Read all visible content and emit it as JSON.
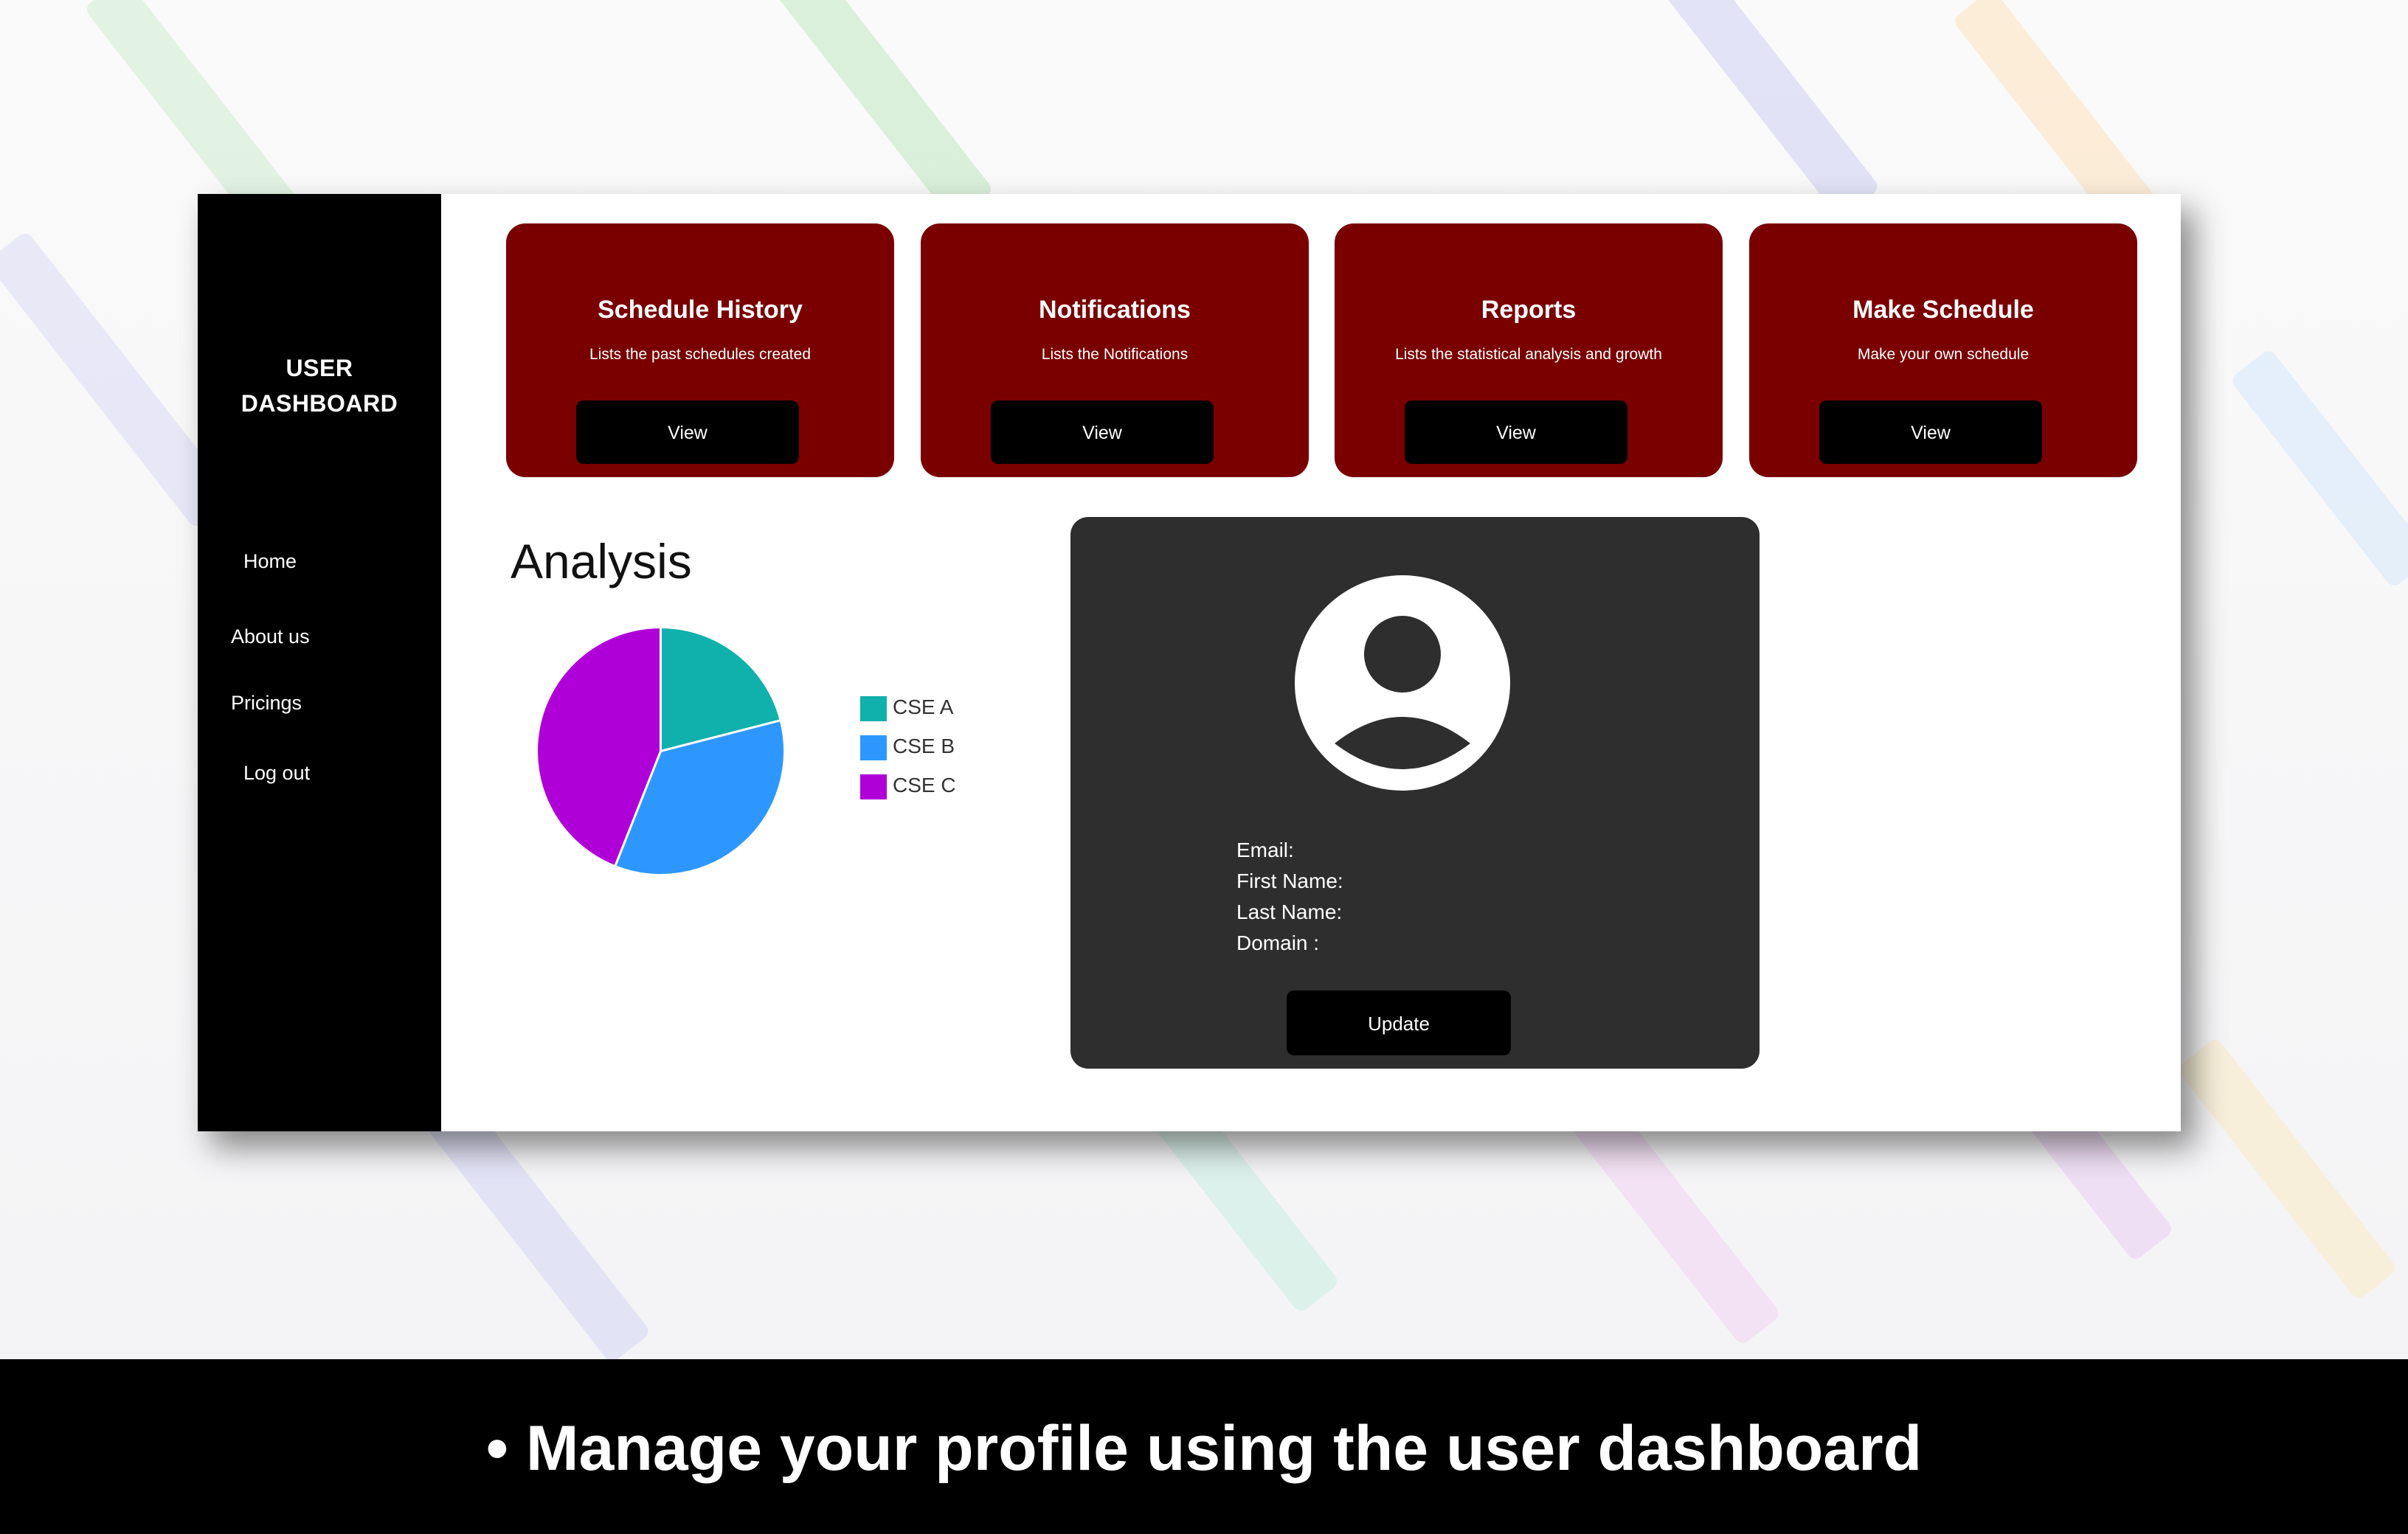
{
  "sidebar": {
    "brand": "USER DASHBOARD",
    "nav": [
      "Home",
      "About us",
      "Pricings",
      "Log out"
    ]
  },
  "cards": [
    {
      "title": "Schedule History",
      "description": "Lists the past schedules created",
      "button": "View"
    },
    {
      "title": "Notifications",
      "description": "Lists the Notifications",
      "button": "View"
    },
    {
      "title": "Reports",
      "description": "Lists the statistical analysis and growth",
      "button": "View"
    },
    {
      "title": "Make Schedule",
      "description": "Make your own schedule",
      "button": "View"
    }
  ],
  "analysis": {
    "title": "Analysis"
  },
  "chart_data": {
    "type": "pie",
    "categories": [
      "CSE A",
      "CSE B",
      "CSE C"
    ],
    "values": [
      21,
      35,
      44
    ],
    "colors": [
      "#10b0ac",
      "#2d97ff",
      "#b000d8"
    ],
    "legend_position": "right"
  },
  "profile": {
    "avatar_icon": "user-avatar-icon",
    "fields": [
      "Email:",
      "First Name:",
      "Last Name:",
      "Domain :"
    ],
    "update_button": "Update"
  },
  "caption": "• Manage your profile using the user dashboard",
  "colors": {
    "card": "#7a0000",
    "sidebar": "#000000",
    "profile_panel": "#2e2e2e"
  }
}
